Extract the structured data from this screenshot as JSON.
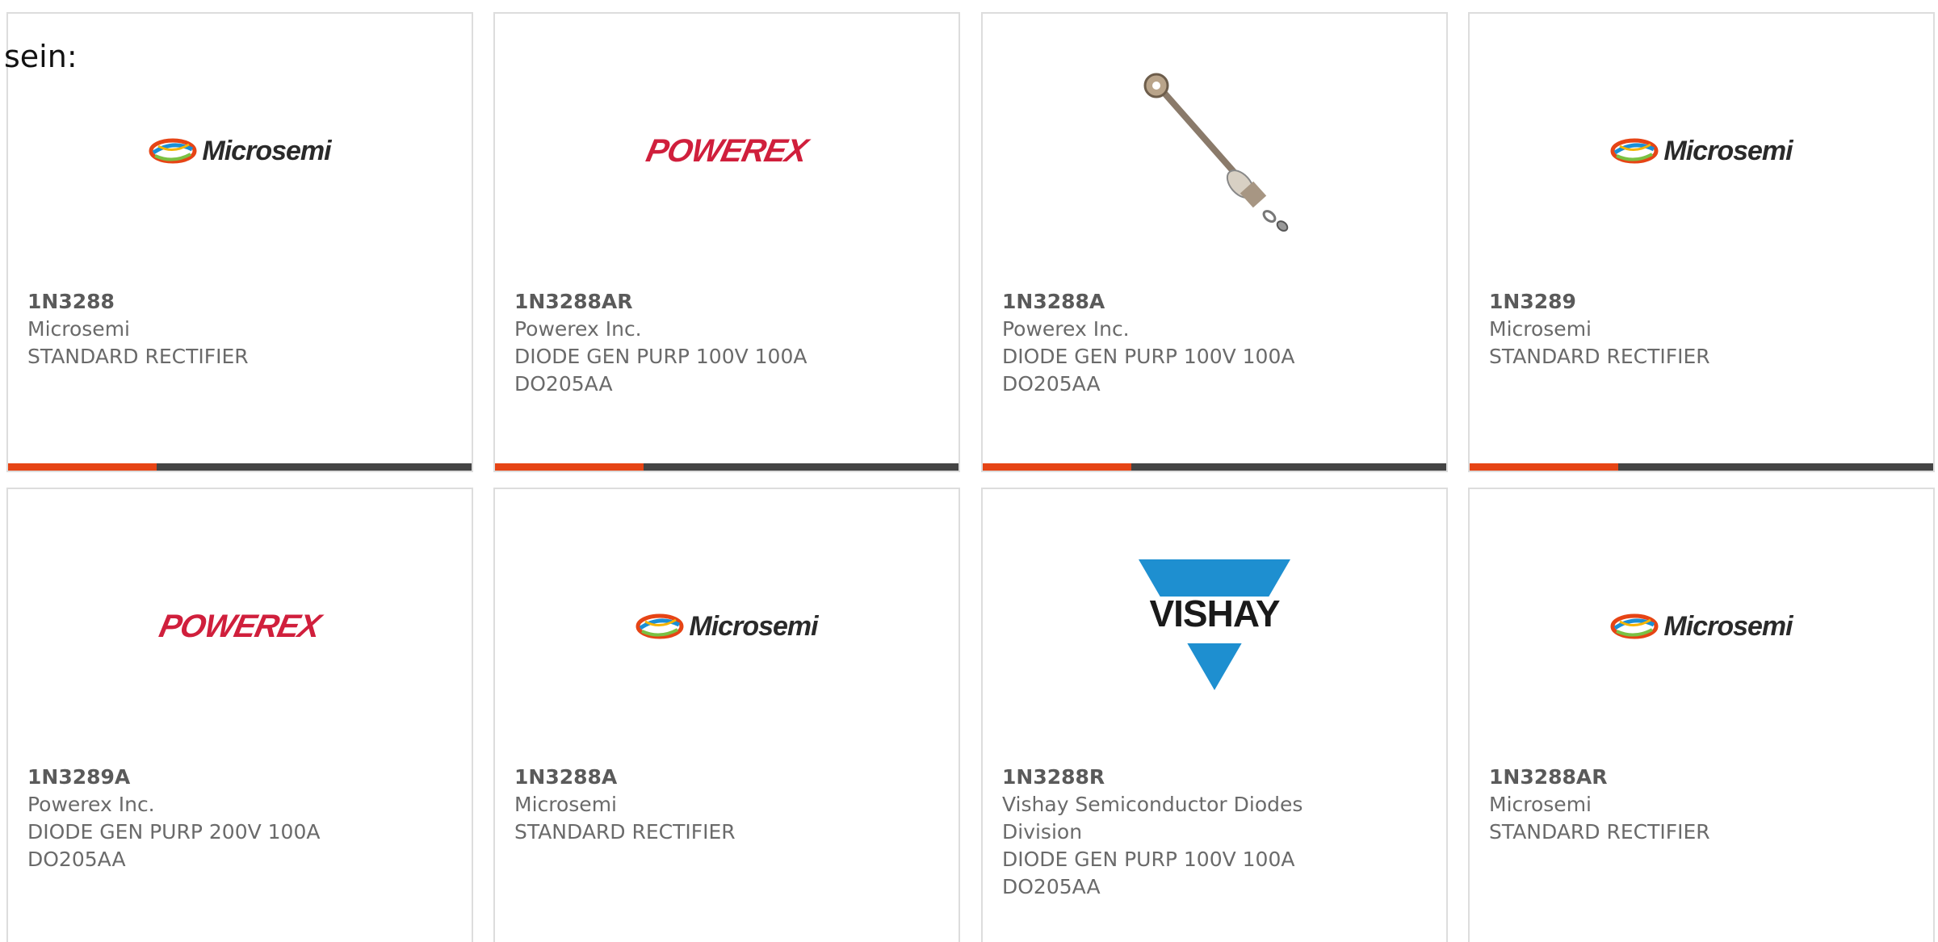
{
  "intro_text": "sein:",
  "accent_color": "#e64415",
  "products": [
    {
      "part_number": "1N3288",
      "manufacturer": "Microsemi",
      "description_lines": [
        "STANDARD RECTIFIER"
      ],
      "logo": "Microsemi",
      "progress": 0.32
    },
    {
      "part_number": "1N3288AR",
      "manufacturer": "Powerex Inc.",
      "description_lines": [
        "DIODE GEN PURP 100V 100A",
        "DO205AA"
      ],
      "logo": "POWEREX",
      "progress": 0.32
    },
    {
      "part_number": "1N3288A",
      "manufacturer": "Powerex Inc.",
      "description_lines": [
        "DIODE GEN PURP 100V 100A",
        "DO205AA"
      ],
      "logo": "stud-diode-photo",
      "progress": 0.32
    },
    {
      "part_number": "1N3289",
      "manufacturer": "Microsemi",
      "description_lines": [
        "STANDARD RECTIFIER"
      ],
      "logo": "Microsemi",
      "progress": 0.32
    },
    {
      "part_number": "1N3289A",
      "manufacturer": "Powerex Inc.",
      "description_lines": [
        "DIODE GEN PURP 200V 100A",
        "DO205AA"
      ],
      "logo": "POWEREX"
    },
    {
      "part_number": "1N3288A",
      "manufacturer": "Microsemi",
      "description_lines": [
        "STANDARD RECTIFIER"
      ],
      "logo": "Microsemi"
    },
    {
      "part_number": "1N3288R",
      "manufacturer": "Vishay Semiconductor Diodes Division",
      "description_lines": [
        "DIODE GEN PURP 100V 100A",
        "DO205AA"
      ],
      "logo": "VISHAY"
    },
    {
      "part_number": "1N3288AR",
      "manufacturer": "Microsemi",
      "description_lines": [
        "STANDARD RECTIFIER"
      ],
      "logo": "Microsemi"
    }
  ]
}
